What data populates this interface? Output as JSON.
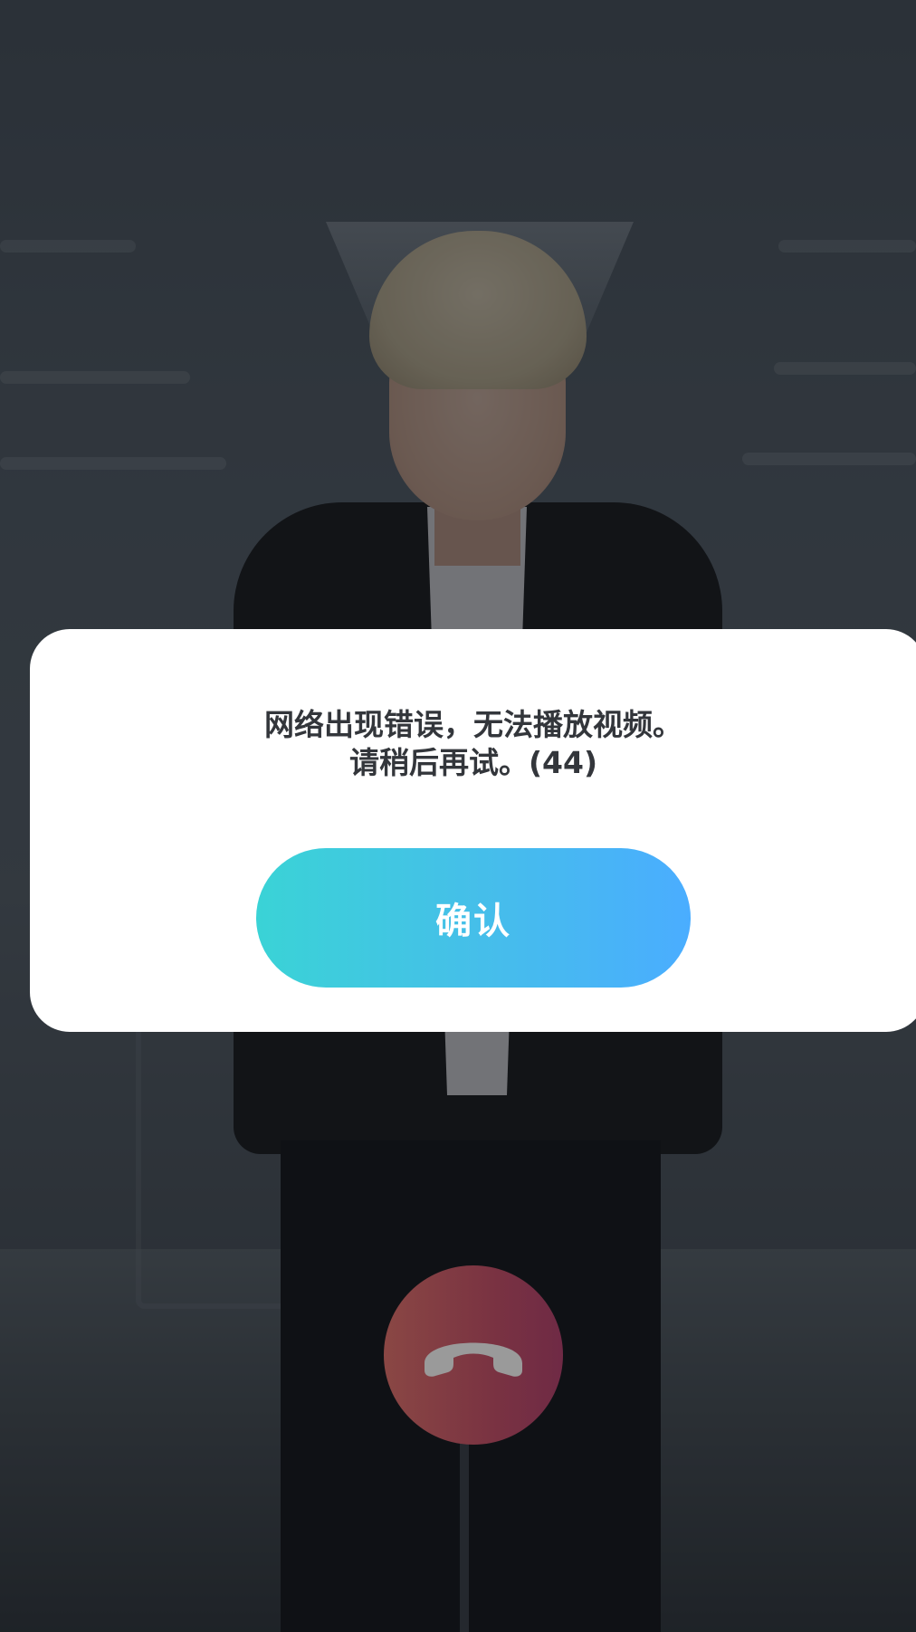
{
  "app": {
    "screen": "video-call"
  },
  "dialog": {
    "message_line1": "网络出现错误，无法播放视频。",
    "message_line2": "请稍后再试。(44)",
    "confirm_label": "确认"
  },
  "call_controls": {
    "hangup_icon": "phone-hangup-icon"
  },
  "colors": {
    "dialog_background": "#ffffff",
    "message_text": "#33363b",
    "confirm_gradient_start": "#3ad3d6",
    "confirm_gradient_end": "#4aadff",
    "confirm_text": "#ffffff",
    "hangup_background": "#7a3342",
    "hangup_icon": "#9a9a9a"
  }
}
